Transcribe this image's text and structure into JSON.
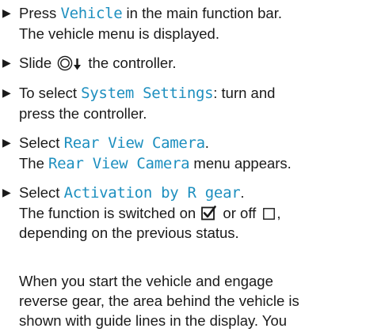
{
  "steps": [
    {
      "lines": [
        [
          "Press ",
          {
            "term": "Vehicle"
          },
          " in the main function bar."
        ],
        [
          "The vehicle menu is displayed."
        ]
      ]
    },
    {
      "lines": [
        [
          "Slide ",
          {
            "icon": "controller-icon"
          },
          {
            "icon": "slide-down-arrow-icon"
          },
          " the controller."
        ]
      ]
    },
    {
      "lines": [
        [
          "To select ",
          {
            "term": "System Settings"
          },
          ": turn and"
        ],
        [
          "press the controller."
        ]
      ]
    },
    {
      "lines": [
        [
          "Select ",
          {
            "term": "Rear View Camera"
          },
          "."
        ],
        [
          "The ",
          {
            "term": "Rear View Camera"
          },
          " menu appears."
        ]
      ]
    },
    {
      "lines": [
        [
          "Select ",
          {
            "term": "Activation by R gear"
          },
          "."
        ],
        [
          "The function is switched on ",
          {
            "icon": "checkbox-checked-icon"
          },
          " or off ",
          {
            "icon": "checkbox-empty-icon"
          },
          ","
        ],
        [
          "depending on the previous status."
        ]
      ]
    }
  ],
  "paragraph": {
    "lines": [
      "When you start the vehicle and engage",
      "reverse gear, the area behind the vehicle is",
      "shown with guide lines in the display. You"
    ]
  },
  "bullet_glyph": "▶",
  "colors": {
    "term": "#1d8fbf",
    "text": "#1a1a1a",
    "background": "#ffffff"
  }
}
